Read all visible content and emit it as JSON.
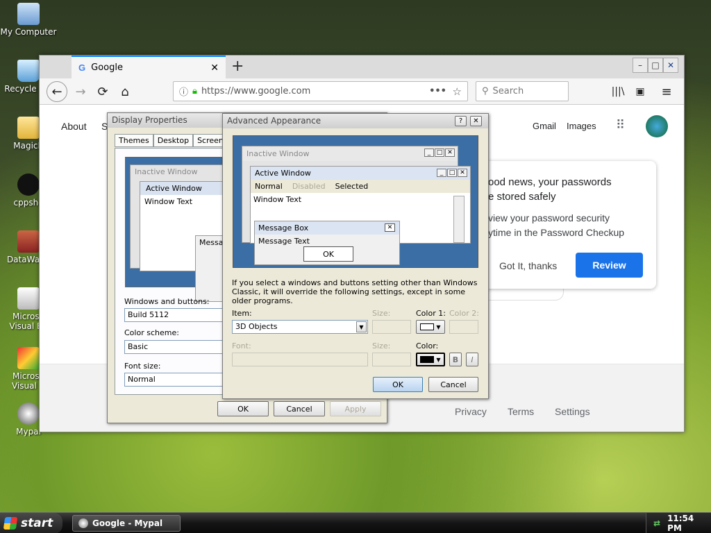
{
  "desktop": {
    "icons": [
      {
        "label": "My Computer",
        "icon": "computer-icon"
      },
      {
        "label": "Recycle Bin",
        "icon": "recycle-bin-icon"
      },
      {
        "label": "MagicB",
        "icon": "folder-icon"
      },
      {
        "label": "cppsho",
        "icon": "app-icon"
      },
      {
        "label": "DataWage",
        "icon": "app-icon"
      },
      {
        "label": "Microso Visual Ba",
        "icon": "app-icon"
      },
      {
        "label": "Microso Visual C",
        "icon": "app-icon"
      },
      {
        "label": "Mypal",
        "icon": "app-icon"
      }
    ]
  },
  "taskbar": {
    "start_label": "start",
    "task_label": "Google - Mypal",
    "clock": "11:54 PM"
  },
  "browser": {
    "tab_title": "Google",
    "url": "https://www.google.com",
    "search_placeholder": "Search",
    "page": {
      "about": "About",
      "store_fragment": "S",
      "gmail": "Gmail",
      "images": "Images",
      "card_title_1": "ood news, your passwords",
      "card_title_2": "e stored safely",
      "card_text_1": "view your password security",
      "card_text_2": "ytime in the Password Checkup",
      "got_it": "Got It, thanks",
      "review": "Review"
    },
    "footer": {
      "privacy": "Privacy",
      "terms": "Terms",
      "settings": "Settings"
    }
  },
  "display_props": {
    "title": "Display Properties",
    "tabs": [
      "Themes",
      "Desktop",
      "Screen Sa"
    ],
    "preview": {
      "inactive": "Inactive Window",
      "active": "Active Window",
      "window_text": "Window Text",
      "message": "Messa"
    },
    "windows_buttons_label": "Windows and buttons:",
    "windows_buttons_value": "Build 5112",
    "color_scheme_label": "Color scheme:",
    "color_scheme_value": "Basic",
    "font_size_label": "Font size:",
    "font_size_value": "Normal",
    "ok": "OK",
    "cancel": "Cancel",
    "apply": "Apply"
  },
  "advanced": {
    "title": "Advanced Appearance",
    "help": "?",
    "preview": {
      "inactive": "Inactive Window",
      "active": "Active Window",
      "menu": [
        "Normal",
        "Disabled",
        "Selected"
      ],
      "window_text": "Window Text",
      "message_box": "Message Box",
      "message_text": "Message Text",
      "ok": "OK"
    },
    "note": "If you select a windows and buttons setting other than Windows Classic, it will override the following settings, except in some older programs.",
    "item_label": "Item:",
    "item_value": "3D Objects",
    "size_label": "Size:",
    "color1_label": "Color 1:",
    "color2_label": "Color 2:",
    "font_label": "Font:",
    "size2_label": "Size:",
    "color_label": "Color:",
    "bold": "B",
    "italic": "I",
    "ok": "OK",
    "cancel": "Cancel"
  },
  "colors": {
    "accent": "#0a84ff",
    "review_button": "#1a73e8",
    "preview_bg": "#3a6ea5"
  }
}
